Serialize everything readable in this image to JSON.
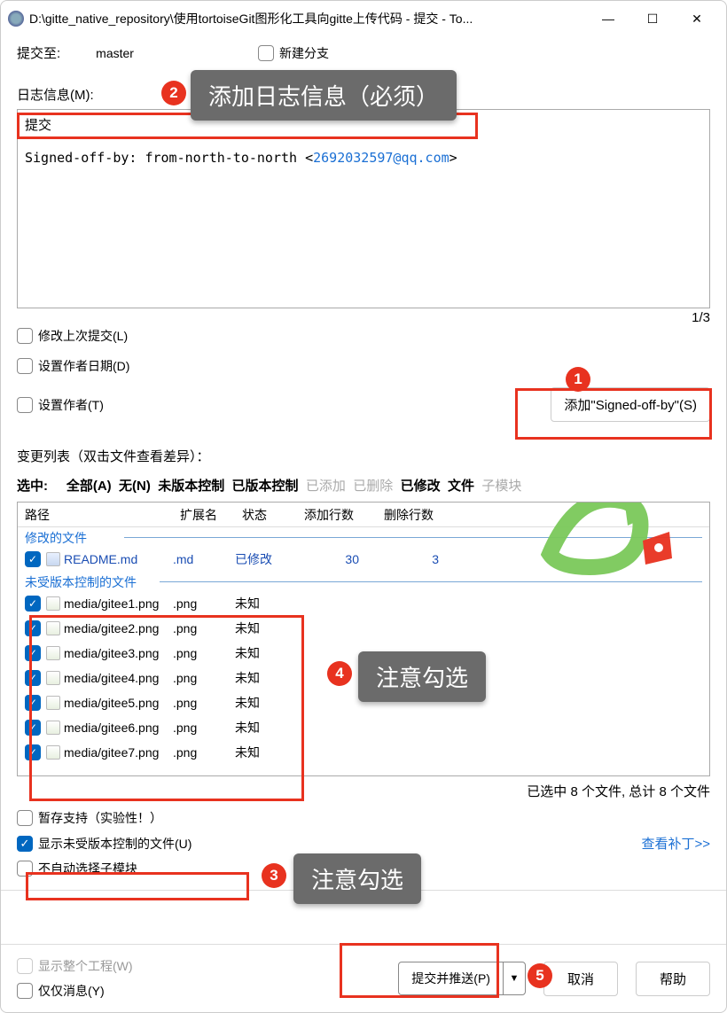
{
  "window": {
    "title": "D:\\gitte_native_repository\\使用tortoiseGit图形化工具向gitte上传代码 - 提交 - To...",
    "minimize": "—",
    "maximize": "☐",
    "close": "✕"
  },
  "commit_to_label": "提交至:",
  "branch": "master",
  "new_branch_label": "新建分支",
  "log_label": "日志信息(M):",
  "commit_message_line1": "提交",
  "commit_message_line2_prefix": "Signed-off-by: from-north-to-north <",
  "commit_message_email": "2692032597@qq.com",
  "commit_message_line2_suffix": ">",
  "counter": "1/3",
  "amend_label": "修改上次提交(L)",
  "set_author_date_label": "设置作者日期(D)",
  "set_author_label": "设置作者(T)",
  "signed_off_btn": "添加\"Signed-off-by\"(S)",
  "changes_label": "变更列表（双击文件查看差异）：",
  "filter": {
    "selected": "选中:",
    "all": "全部(A)",
    "none": "无(N)",
    "unversioned": "未版本控制",
    "versioned": "已版本控制",
    "added": "已添加",
    "deleted": "已删除",
    "modified": "已修改",
    "files": "文件",
    "submodules": "子模块"
  },
  "columns": {
    "path": "路径",
    "ext": "扩展名",
    "status": "状态",
    "add_lines": "添加行数",
    "del_lines": "删除行数"
  },
  "group_modified": "修改的文件",
  "group_unversioned": "未受版本控制的文件",
  "files": [
    {
      "path": "README.md",
      "ext": ".md",
      "status": "已修改",
      "add": "30",
      "del": "3",
      "modified": true
    },
    {
      "path": "media/gitee1.png",
      "ext": ".png",
      "status": "未知",
      "add": "",
      "del": ""
    },
    {
      "path": "media/gitee2.png",
      "ext": ".png",
      "status": "未知",
      "add": "",
      "del": ""
    },
    {
      "path": "media/gitee3.png",
      "ext": ".png",
      "status": "未知",
      "add": "",
      "del": ""
    },
    {
      "path": "media/gitee4.png",
      "ext": ".png",
      "status": "未知",
      "add": "",
      "del": ""
    },
    {
      "path": "media/gitee5.png",
      "ext": ".png",
      "status": "未知",
      "add": "",
      "del": ""
    },
    {
      "path": "media/gitee6.png",
      "ext": ".png",
      "status": "未知",
      "add": "",
      "del": ""
    },
    {
      "path": "media/gitee7.png",
      "ext": ".png",
      "status": "未知",
      "add": "",
      "del": ""
    }
  ],
  "summary": "已选中 8 个文件, 总计 8 个文件",
  "stash_label": "暂存支持（实验性！）",
  "show_unversioned_label": "显示未受版本控制的文件(U)",
  "no_auto_submodule_label": "不自动选择子模块",
  "view_patch_link": "查看补丁>>",
  "show_whole_project_label": "显示整个工程(W)",
  "message_only_label": "仅仅消息(Y)",
  "commit_push_btn": "提交并推送(P)",
  "cancel_btn": "取消",
  "help_btn": "帮助",
  "annotations": {
    "a1": "1",
    "a2": "2",
    "a2_text": "添加日志信息（必须）",
    "a3": "3",
    "a3_text": "注意勾选",
    "a4": "4",
    "a4_text": "注意勾选",
    "a5": "5"
  }
}
